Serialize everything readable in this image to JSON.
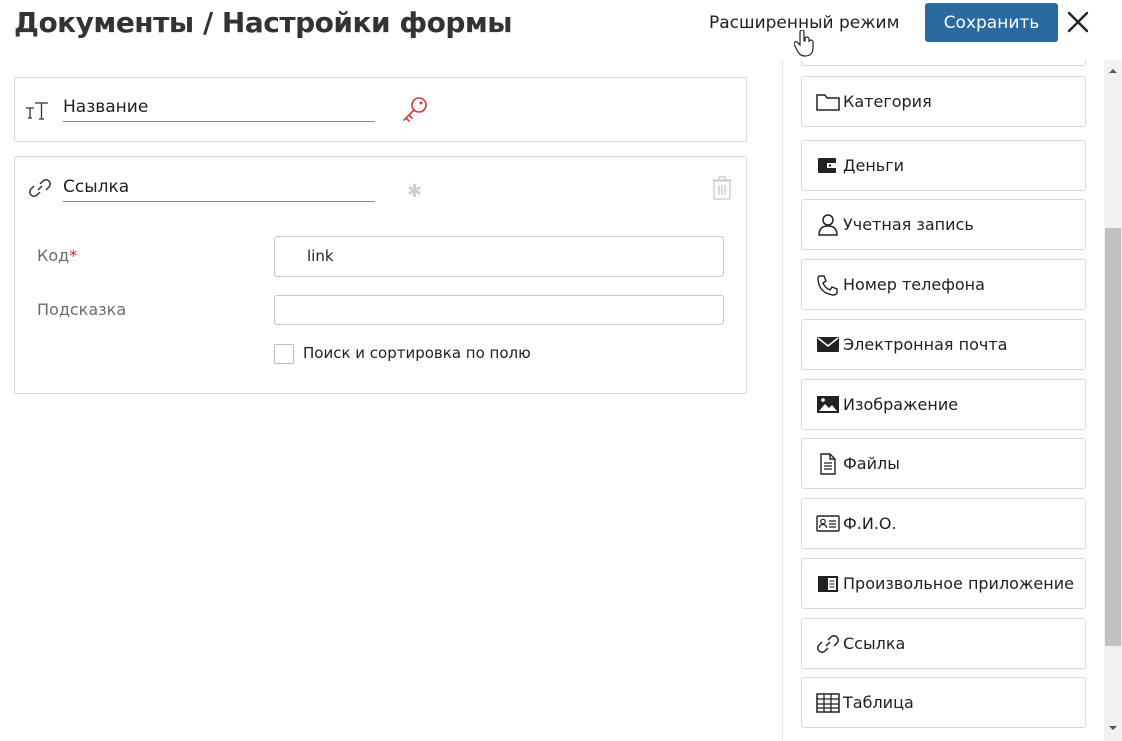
{
  "header": {
    "title": "Документы / Настройки формы",
    "advanced_mode": "Расширенный режим",
    "save_label": "Сохранить"
  },
  "fields": {
    "name_field": {
      "label": "Название"
    },
    "link_field": {
      "label": "Ссылка",
      "code_label": "Код",
      "code_required": "*",
      "code_value": "link",
      "hint_label": "Подсказка",
      "hint_value": "",
      "search_sort_label": "Поиск и сортировка по полю",
      "search_sort_checked": false
    }
  },
  "field_types": [
    {
      "label": "Категория",
      "icon": "folder-icon"
    },
    {
      "label": "Деньги",
      "icon": "wallet-icon"
    },
    {
      "label": "Учетная запись",
      "icon": "user-icon"
    },
    {
      "label": "Номер телефона",
      "icon": "phone-icon"
    },
    {
      "label": "Электронная почта",
      "icon": "envelope-icon"
    },
    {
      "label": "Изображение",
      "icon": "image-icon"
    },
    {
      "label": "Файлы",
      "icon": "file-icon"
    },
    {
      "label": "Ф.И.О.",
      "icon": "id-card-icon"
    },
    {
      "label": "Произвольное приложение",
      "icon": "app-icon"
    },
    {
      "label": "Ссылка",
      "icon": "link-icon"
    },
    {
      "label": "Таблица",
      "icon": "table-icon"
    }
  ],
  "colors": {
    "primary": "#2a6a9e",
    "required": "#d21f2a",
    "key_icon": "#d23a3a"
  }
}
